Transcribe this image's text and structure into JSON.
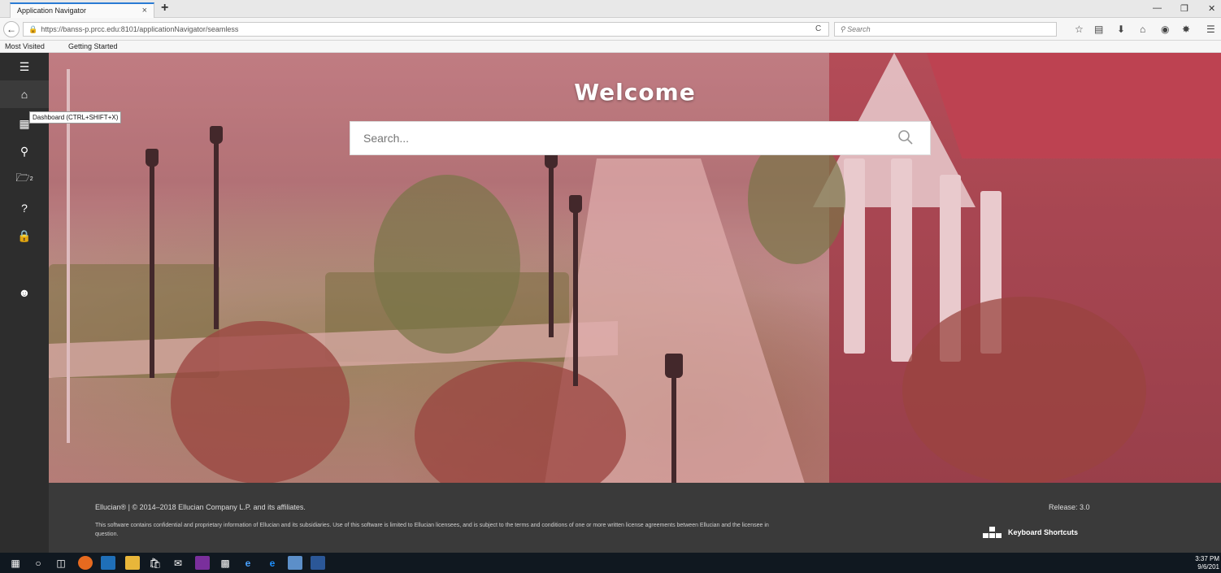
{
  "browser": {
    "tab_title": "Application Navigator",
    "tab_close": "×",
    "new_tab": "+",
    "url": "https://banss-p.prcc.edu:8101/applicationNavigator/seamless",
    "search_placeholder": "Search",
    "reload": "C",
    "bookmarks": [
      "Most Visited",
      "Getting Started"
    ]
  },
  "sidebar": {
    "tooltip": "Dashboard (CTRL+SHIFT+X)",
    "badge": "2"
  },
  "hero": {
    "title": "Welcome",
    "search_placeholder": "Search..."
  },
  "footer": {
    "copyright": "Ellucian® | © 2014–2018 Ellucian Company L.P. and its affiliates.",
    "legal": "This software contains confidential and proprietary information of Ellucian and its subsidiaries. Use of this software is limited to Ellucian licensees, and is subject to the terms and conditions of one or more written license agreements between Ellucian and the licensee in question.",
    "release": "Release: 3.0",
    "keyboard_shortcuts": "Keyboard Shortcuts"
  },
  "taskbar": {
    "time": "3:37 PM",
    "date": "9/6/201"
  }
}
